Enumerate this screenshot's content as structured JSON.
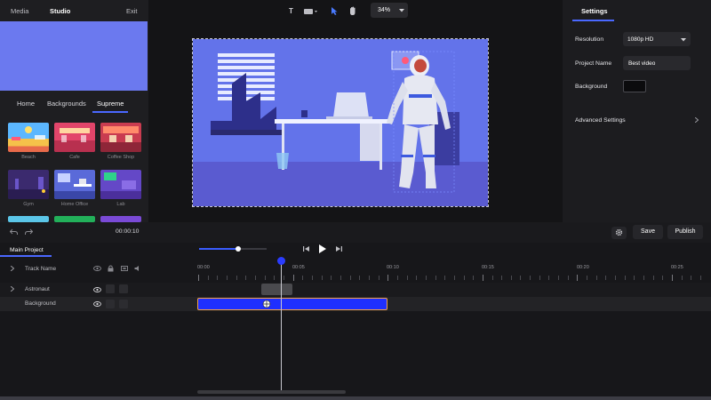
{
  "left_panel": {
    "tabs": [
      "Media",
      "Studio",
      "Exit"
    ],
    "sub_tabs": [
      "Home",
      "Backgrounds",
      "Supreme"
    ],
    "thumbnails": [
      {
        "label": "Beach"
      },
      {
        "label": "Cafe"
      },
      {
        "label": "Coffee Shop"
      },
      {
        "label": "Gym"
      },
      {
        "label": "Home Office"
      },
      {
        "label": "Lab"
      }
    ]
  },
  "toolbar": {
    "zoom_value": "34%"
  },
  "settings": {
    "title": "Settings",
    "resolution_label": "Resolution",
    "resolution_value": "1080p HD",
    "project_name_label": "Project Name",
    "project_name_value": "Best video",
    "background_label": "Background",
    "background_color": "#0b0b0d",
    "advanced_label": "Advanced Settings"
  },
  "playback": {
    "time_display": "00:00:10"
  },
  "actions": {
    "save_label": "Save",
    "publish_label": "Publish"
  },
  "timeline": {
    "tab_label": "Main Project",
    "header_label": "Track Name",
    "ticks": [
      "00:00",
      "00:05",
      "00:10",
      "00:15",
      "00:20",
      "00:25"
    ],
    "tracks": [
      {
        "name": "Astronaut"
      },
      {
        "name": "Background"
      }
    ]
  },
  "colors": {
    "accent": "#2a3cff",
    "clip_border": "#f0a04a",
    "canvas_bg": "#5f6fe8"
  }
}
